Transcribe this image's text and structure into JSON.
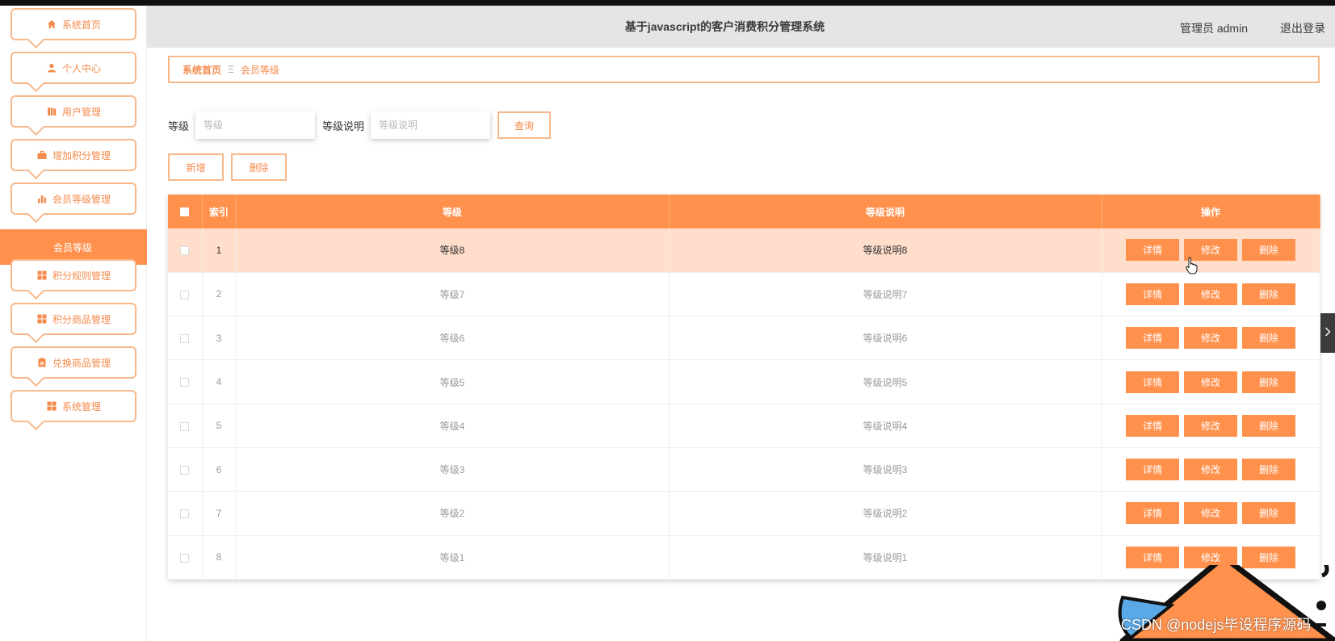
{
  "header": {
    "title": "基于javascript的客户消费积分管理系统",
    "user": "管理员 admin",
    "logout": "退出登录"
  },
  "sidebar": {
    "items": [
      {
        "label": "系统首页",
        "icon": "home-icon"
      },
      {
        "label": "个人中心",
        "icon": "user-icon"
      },
      {
        "label": "用户管理",
        "icon": "book-icon"
      },
      {
        "label": "增加积分管理",
        "icon": "briefcase-icon"
      },
      {
        "label": "会员等级管理",
        "icon": "bar-chart-icon"
      },
      {
        "label": "积分规则管理",
        "icon": "grid-icon"
      },
      {
        "label": "积分商品管理",
        "icon": "grid-icon"
      },
      {
        "label": "兑换商品管理",
        "icon": "clipboard-icon"
      },
      {
        "label": "系统管理",
        "icon": "grid-icon"
      }
    ],
    "active_sub": "会员等级"
  },
  "breadcrumb": {
    "home": "系统首页",
    "sep": "Ξ",
    "current": "会员等级"
  },
  "search": {
    "level_label": "等级",
    "level_placeholder": "等级",
    "desc_label": "等级说明",
    "desc_placeholder": "等级说明",
    "query_button": "查询"
  },
  "actions": {
    "add": "新增",
    "delete": "删除"
  },
  "table": {
    "columns": [
      "索引",
      "等级",
      "等级说明",
      "操作"
    ],
    "rows": [
      {
        "index": "1",
        "level": "等级8",
        "desc": "等级说明8"
      },
      {
        "index": "2",
        "level": "等级7",
        "desc": "等级说明7"
      },
      {
        "index": "3",
        "level": "等级6",
        "desc": "等级说明6"
      },
      {
        "index": "4",
        "level": "等级5",
        "desc": "等级说明5"
      },
      {
        "index": "5",
        "level": "等级4",
        "desc": "等级说明4"
      },
      {
        "index": "6",
        "level": "等级3",
        "desc": "等级说明3"
      },
      {
        "index": "7",
        "level": "等级2",
        "desc": "等级说明2"
      },
      {
        "index": "8",
        "level": "等级1",
        "desc": "等级说明1"
      }
    ],
    "row_buttons": {
      "detail": "详情",
      "edit": "修改",
      "delete": "删除"
    }
  },
  "watermark": "CSDN @nodejs毕设程序源码",
  "colors": {
    "accent": "#ff914d",
    "accent_text": "#f48a4b",
    "border": "#f7b98c",
    "active_row": "#ffdecb"
  }
}
